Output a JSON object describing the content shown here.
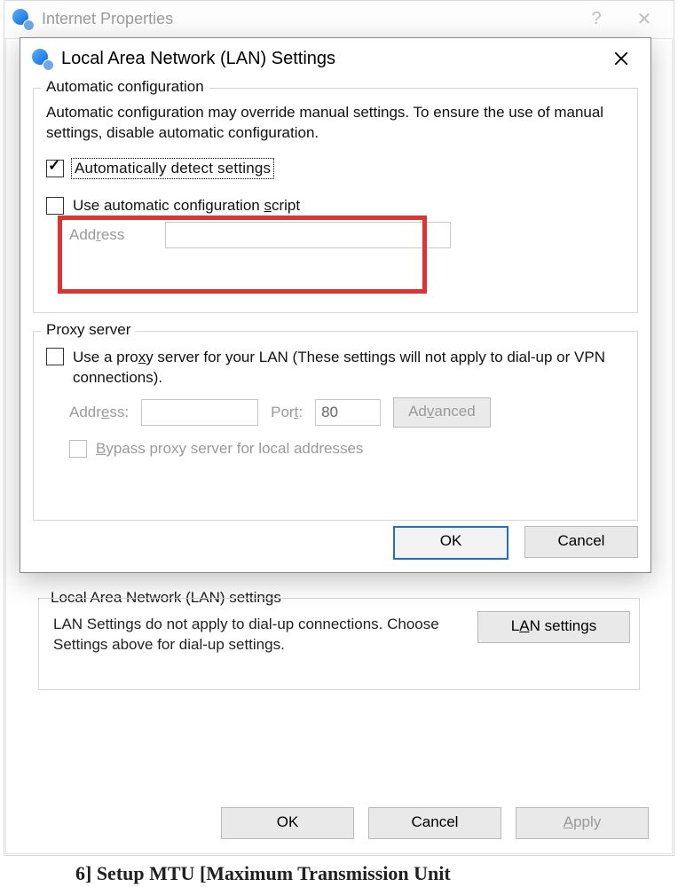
{
  "parent": {
    "title": "Internet Properties",
    "lan_group_label": "Local Area Network (LAN) settings",
    "lan_group_desc": "LAN Settings do not apply to dial-up connections. Choose Settings above for dial-up settings.",
    "lan_settings_btn_pre": "L",
    "lan_settings_btn_ul": "A",
    "lan_settings_btn_post": "N settings",
    "ok": "OK",
    "cancel": "Cancel",
    "apply_pre": "",
    "apply_ul": "A",
    "apply_post": "pply",
    "offscreen_text": "6] Setup MTU [Maximum Transmission Unit"
  },
  "dialog": {
    "title": "Local Area Network (LAN) Settings",
    "auto": {
      "legend": "Automatic configuration",
      "help": "Automatic configuration may override manual settings.  To ensure the use of manual settings, disable automatic configuration.",
      "detect": "Automatically detect settings",
      "script_pre": "Use automatic configuration ",
      "script_ul": "s",
      "script_post": "cript",
      "address_pre": "Add",
      "address_ul": "r",
      "address_post": "ess"
    },
    "proxy": {
      "legend": "Proxy server",
      "use_pre": "Use a pro",
      "use_ul": "x",
      "use_post": "y server for your LAN (These settings will not apply to dial-up or VPN connections).",
      "addr_pre": "Addr",
      "addr_ul": "e",
      "addr_post": "ss:",
      "port_pre": "Por",
      "port_ul": "t",
      "port_post": ":",
      "port_value": "80",
      "adv_pre": "Ad",
      "adv_ul": "v",
      "adv_post": "anced",
      "bypass_pre": "",
      "bypass_ul": "B",
      "bypass_post": "ypass proxy server for local addresses"
    },
    "ok": "OK",
    "cancel": "Cancel"
  }
}
